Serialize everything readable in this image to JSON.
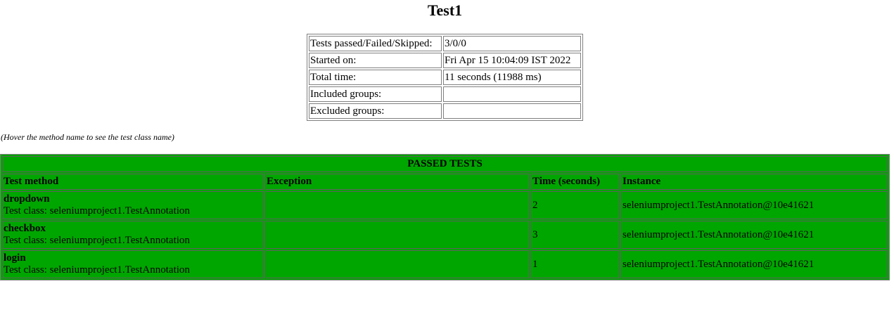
{
  "page": {
    "title": "Test1",
    "hint": "(Hover the method name to see the test class name)"
  },
  "summary": {
    "rows": [
      {
        "label": "Tests passed/Failed/Skipped:",
        "value": "3/0/0"
      },
      {
        "label": "Started on:",
        "value": "Fri Apr 15 10:04:09 IST 2022"
      },
      {
        "label": "Total time:",
        "value": "11 seconds (11988 ms)"
      },
      {
        "label": "Included groups:",
        "value": ""
      },
      {
        "label": "Excluded groups:",
        "value": ""
      }
    ]
  },
  "results": {
    "section_title": "PASSED TESTS",
    "columns": [
      "Test method",
      "Exception",
      "Time (seconds)",
      "Instance"
    ],
    "rows": [
      {
        "method": "dropdown",
        "test_class": "Test class: seleniumproject1.TestAnnotation",
        "exception": "",
        "time": "2",
        "instance": "seleniumproject1.TestAnnotation@10e41621"
      },
      {
        "method": "checkbox",
        "test_class": "Test class: seleniumproject1.TestAnnotation",
        "exception": "",
        "time": "3",
        "instance": "seleniumproject1.TestAnnotation@10e41621"
      },
      {
        "method": "login",
        "test_class": "Test class: seleniumproject1.TestAnnotation",
        "exception": "",
        "time": "1",
        "instance": "seleniumproject1.TestAnnotation@10e41621"
      }
    ]
  },
  "colors": {
    "passed_background": "#00a600",
    "border": "#808080"
  }
}
